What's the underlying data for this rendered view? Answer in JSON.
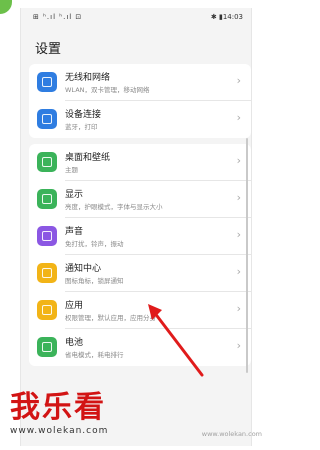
{
  "status": {
    "left": "⊞ ʰ.ıl ʰ.ıl ⊡",
    "right": "✱ ▮14:03"
  },
  "title": "设置",
  "group1": [
    {
      "icon": "wifi-icon",
      "color": "#2f7de1",
      "label": "无线和网络",
      "sub": "WLAN，双卡管理，移动网络"
    },
    {
      "icon": "device-link-icon",
      "color": "#2f7de1",
      "label": "设备连接",
      "sub": "蓝牙，打印"
    }
  ],
  "group2": [
    {
      "icon": "wallpaper-icon",
      "color": "#3bb35a",
      "label": "桌面和壁纸",
      "sub": "主题"
    },
    {
      "icon": "display-icon",
      "color": "#3bb35a",
      "label": "显示",
      "sub": "亮度，护眼模式，字体与显示大小"
    },
    {
      "icon": "sound-icon",
      "color": "#8b57e3",
      "label": "声音",
      "sub": "免打扰，铃声，振动"
    },
    {
      "icon": "notification-icon",
      "color": "#f2b417",
      "label": "通知中心",
      "sub": "图标角标，锁屏通知"
    },
    {
      "icon": "apps-icon",
      "color": "#f2b417",
      "label": "应用",
      "sub": "权限管理，默认应用，应用分身"
    },
    {
      "icon": "battery-icon",
      "color": "#3bb35a",
      "label": "电池",
      "sub": "省电模式，耗电排行"
    }
  ],
  "watermark": {
    "text": "我乐看",
    "url": "www.wolekan.com"
  },
  "corner": "www.wolekan.com"
}
